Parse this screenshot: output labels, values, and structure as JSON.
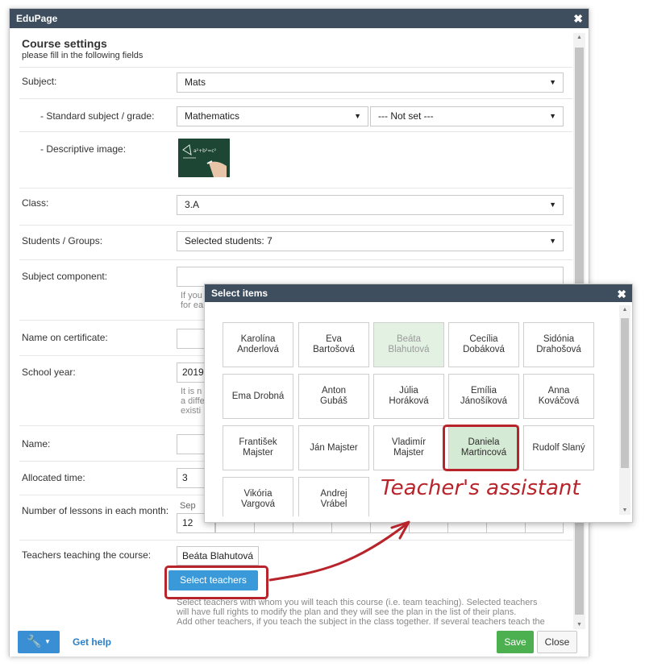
{
  "dialog": {
    "title": "EduPage",
    "heading": "Course settings",
    "subheading": "please fill in the following fields"
  },
  "fields": {
    "subject_label": "Subject:",
    "subject_value": "Mats",
    "standard_label": "- Standard subject / grade:",
    "standard_value": "Mathematics",
    "grade_value": "--- Not set ---",
    "image_label": "- Descriptive image:",
    "class_label": "Class:",
    "class_value": "3.A",
    "students_label": "Students / Groups:",
    "students_value": "Selected students: 7",
    "component_label": "Subject component:",
    "component_help_1": "If you",
    "component_help_2": "for ea",
    "certificate_label": "Name on certificate:",
    "school_year_label": "School year:",
    "school_year_value": "2019",
    "school_year_help_1": "It is n",
    "school_year_help_2": "a diffe",
    "school_year_help_3": "existi",
    "name_label": "Name:",
    "allocated_label": "Allocated time:",
    "allocated_value": "3",
    "lessons_label": "Number of lessons in each month:",
    "month_sep": "Sep",
    "lessons_sep_value": "12",
    "teachers_label": "Teachers teaching the course:",
    "teacher_tag": "Beáta Blahutová",
    "select_teachers_button": "Select teachers",
    "teachers_help_1": "Select teachers with whom you will teach this course (i.e. team teaching). Selected teachers",
    "teachers_help_2": "will have full rights to modify the plan and they will see the plan in the list of their plans.",
    "teachers_help_3": "Add other teachers, if you teach the subject in the class together. If several teachers teach the"
  },
  "footer": {
    "tools_icon": "wrench-icon",
    "help_link": "Get help",
    "save": "Save",
    "close": "Close"
  },
  "select_items": {
    "title": "Select items",
    "items": [
      {
        "l1": "Karolína",
        "l2": "Anderlová"
      },
      {
        "l1": "Eva",
        "l2": "Bartošová"
      },
      {
        "l1": "Beáta",
        "l2": "Blahutová"
      },
      {
        "l1": "Cecília",
        "l2": "Dobáková"
      },
      {
        "l1": "Sidónia",
        "l2": "Drahošová"
      },
      {
        "l1": "Ema Drobná",
        "l2": ""
      },
      {
        "l1": "Anton",
        "l2": "Gubáš"
      },
      {
        "l1": "Júlia",
        "l2": "Horáková"
      },
      {
        "l1": "Emília",
        "l2": "Jánošíková"
      },
      {
        "l1": "Anna",
        "l2": "Kováčová"
      },
      {
        "l1": "František",
        "l2": "Majster"
      },
      {
        "l1": "Ján Majster",
        "l2": ""
      },
      {
        "l1": "Vladimír",
        "l2": "Majster"
      },
      {
        "l1": "Daniela",
        "l2": "Martincová"
      },
      {
        "l1": "Rudolf Slaný",
        "l2": ""
      },
      {
        "l1": "Vikória",
        "l2": "Vargová"
      },
      {
        "l1": "Andrej",
        "l2": "Vrábel"
      }
    ]
  },
  "annotation": {
    "text": "Teacher's assistant",
    "color": "#b8242b"
  }
}
